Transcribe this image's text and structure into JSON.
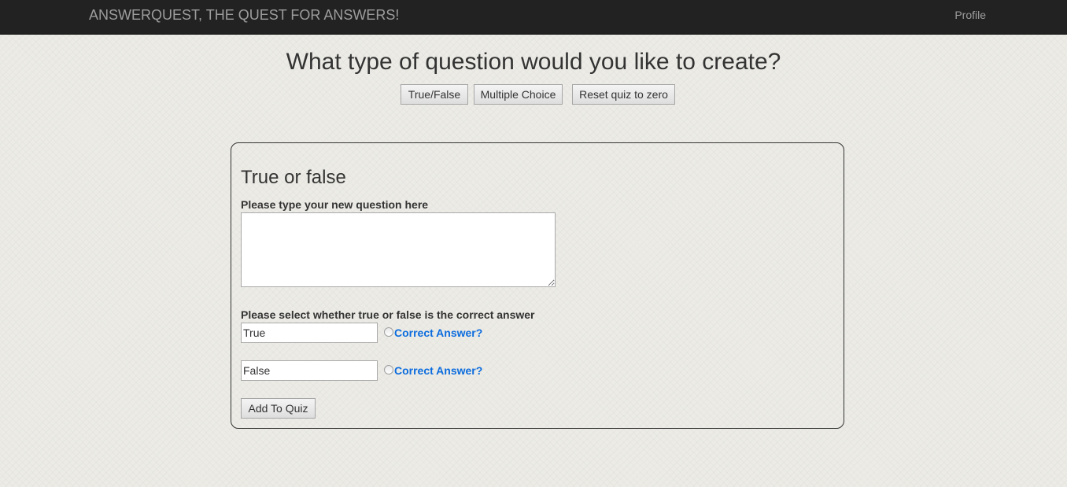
{
  "navbar": {
    "brand": "ANSWERQUEST, THE QUEST FOR ANSWERS!",
    "profile_link": "Profile"
  },
  "page": {
    "heading": "What type of question would you like to create?",
    "buttons": {
      "true_false": "True/False",
      "multiple_choice": "Multiple Choice",
      "reset": "Reset quiz to zero"
    }
  },
  "form": {
    "title": "True or false",
    "question_label": "Please type your new question here",
    "question_value": "",
    "select_label": "Please select whether true or false is the correct answer",
    "answers": [
      {
        "value": "True",
        "link": "Correct Answer?",
        "selected": false
      },
      {
        "value": "False",
        "link": "Correct Answer?",
        "selected": false
      }
    ],
    "submit": "Add To Quiz"
  },
  "colors": {
    "navbar": "#222222",
    "link": "#0b6cde",
    "background": "#ecebe6"
  }
}
